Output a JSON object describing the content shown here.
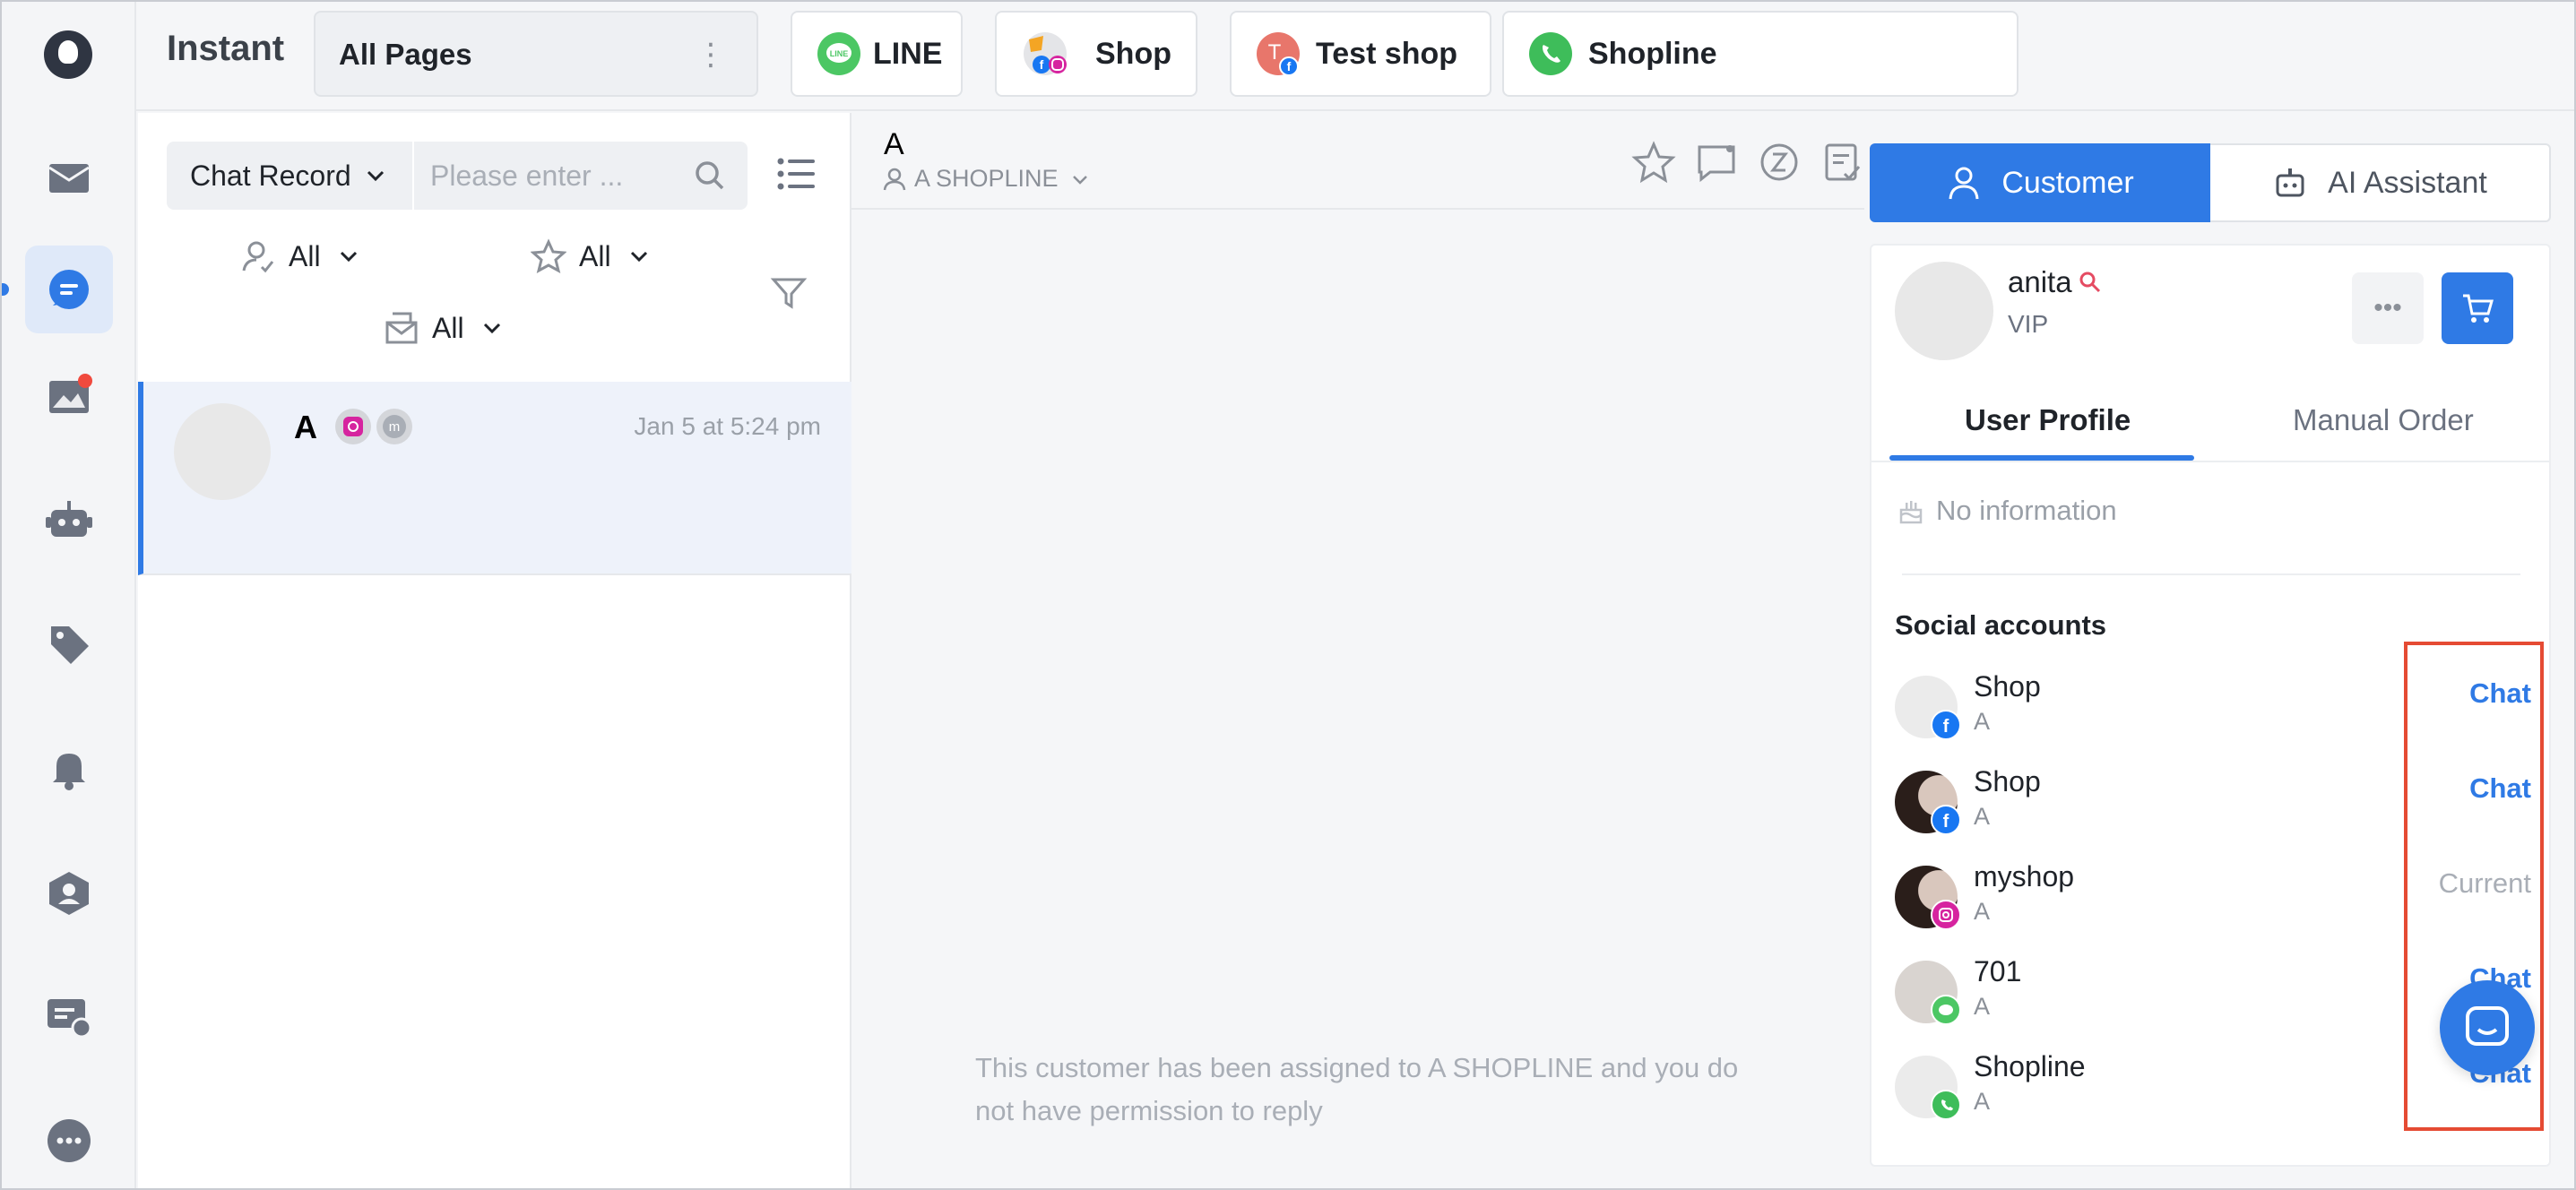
{
  "app": {
    "title": "Instant"
  },
  "topbar": {
    "page_selector": "All Pages",
    "channels": [
      {
        "name": "LINE",
        "icon": "line-icon"
      },
      {
        "name": "Shop",
        "icon": "facebook-instagram-icon"
      },
      {
        "name": "Test shop",
        "icon": "facebook-icon"
      },
      {
        "name": "Shopline",
        "icon": "whatsapp-icon"
      }
    ]
  },
  "sidebar": {
    "items": [
      {
        "name": "inbox",
        "icon": "mail-icon"
      },
      {
        "name": "chat",
        "icon": "chat-icon",
        "active": true
      },
      {
        "name": "posts",
        "icon": "image-icon",
        "has_notification": true
      },
      {
        "name": "bot",
        "icon": "robot-icon"
      },
      {
        "name": "tags",
        "icon": "tag-icon"
      },
      {
        "name": "notifications",
        "icon": "bell-icon"
      },
      {
        "name": "contacts",
        "icon": "user-shield-icon"
      },
      {
        "name": "broadcast",
        "icon": "message-settings-icon"
      },
      {
        "name": "more",
        "icon": "more-icon"
      }
    ]
  },
  "list_panel": {
    "record_type": "Chat Record",
    "search_placeholder": "Please enter ...",
    "filters": {
      "assignee": "All",
      "starred": "All",
      "inbox": "All"
    },
    "conversations": [
      {
        "name": "A",
        "time": "Jan 5 at 5:24 pm",
        "channels": [
          "instagram",
          "m"
        ]
      }
    ]
  },
  "chat": {
    "title": "A",
    "assignee": "A SHOPLINE",
    "note": "This customer has been assigned to A SHOPLINE and you do not have permission to reply"
  },
  "right_panel": {
    "tabs": {
      "customer": "Customer",
      "ai": "AI Assistant"
    },
    "profile": {
      "name": "anita",
      "tier": "VIP"
    },
    "sub_tabs": {
      "profile": "User Profile",
      "order": "Manual Order"
    },
    "no_info": "No information",
    "social_title": "Social accounts",
    "social_accounts": [
      {
        "name": "Shop",
        "sub": "A",
        "channel": "facebook",
        "action": "Chat"
      },
      {
        "name": "Shop",
        "sub": "A",
        "channel": "facebook",
        "action": "Chat"
      },
      {
        "name": "myshop",
        "sub": "A",
        "channel": "instagram",
        "action": "Current"
      },
      {
        "name": "701",
        "sub": "A",
        "channel": "line",
        "action": "Chat"
      },
      {
        "name": "Shopline",
        "sub": "A",
        "channel": "whatsapp",
        "action": "Chat"
      }
    ]
  },
  "colors": {
    "accent": "#2f7ae5",
    "highlight": "#e54b33",
    "notification": "#f04a3e"
  }
}
